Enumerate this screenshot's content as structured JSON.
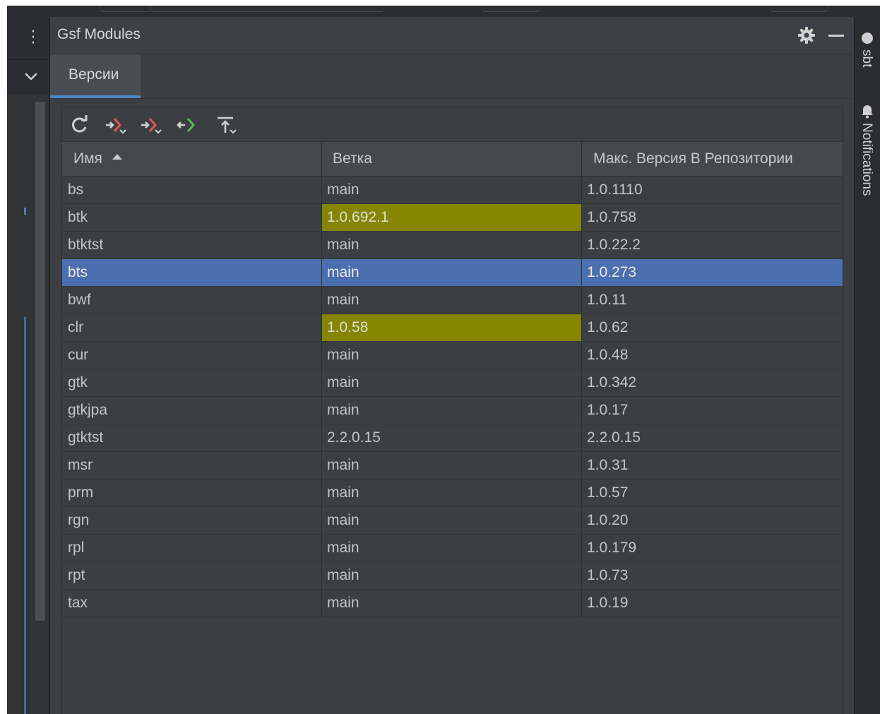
{
  "window": {
    "title": "Gsf Modules"
  },
  "tabs": [
    {
      "label": "Версии",
      "active": true
    }
  ],
  "toolbar": {
    "buttons": [
      {
        "icon": "refresh-icon"
      },
      {
        "icon": "branch-checkout-red-icon"
      },
      {
        "icon": "branch-checkout-red-icon"
      },
      {
        "icon": "merge-green-icon"
      },
      {
        "icon": "push-to-top-icon"
      }
    ]
  },
  "table": {
    "columns": [
      "Имя",
      "Ветка",
      "Макс. Версия В Репозитории"
    ],
    "sort": {
      "column": 0,
      "direction": "ascending"
    },
    "rows": [
      {
        "name": "bs",
        "branch": "main",
        "version": "1.0.1110"
      },
      {
        "name": "btk",
        "branch": "1.0.692.1",
        "version": "1.0.758",
        "branch_highlight": true
      },
      {
        "name": "btktst",
        "branch": "main",
        "version": "1.0.22.2"
      },
      {
        "name": "bts",
        "branch": "main",
        "version": "1.0.273",
        "selected": true
      },
      {
        "name": "bwf",
        "branch": "main",
        "version": "1.0.11"
      },
      {
        "name": "clr",
        "branch": "1.0.58",
        "version": "1.0.62",
        "branch_highlight": true
      },
      {
        "name": "cur",
        "branch": "main",
        "version": "1.0.48"
      },
      {
        "name": "gtk",
        "branch": "main",
        "version": "1.0.342"
      },
      {
        "name": "gtkjpa",
        "branch": "main",
        "version": "1.0.17"
      },
      {
        "name": "gtktst",
        "branch": "2.2.0.15",
        "version": "2.2.0.15"
      },
      {
        "name": "msr",
        "branch": "main",
        "version": "1.0.31"
      },
      {
        "name": "prm",
        "branch": "main",
        "version": "1.0.57"
      },
      {
        "name": "rgn",
        "branch": "main",
        "version": "1.0.20"
      },
      {
        "name": "rpl",
        "branch": "main",
        "version": "1.0.179"
      },
      {
        "name": "rpt",
        "branch": "main",
        "version": "1.0.73"
      },
      {
        "name": "tax",
        "branch": "main",
        "version": "1.0.19"
      }
    ]
  },
  "right_strip": {
    "items": [
      "sbt",
      "Notifications"
    ]
  },
  "colors": {
    "background": "#3c3f41",
    "selected_row": "#4b6eaf",
    "branch_highlight": "#858500",
    "tab_underline": "#4a88c7"
  }
}
